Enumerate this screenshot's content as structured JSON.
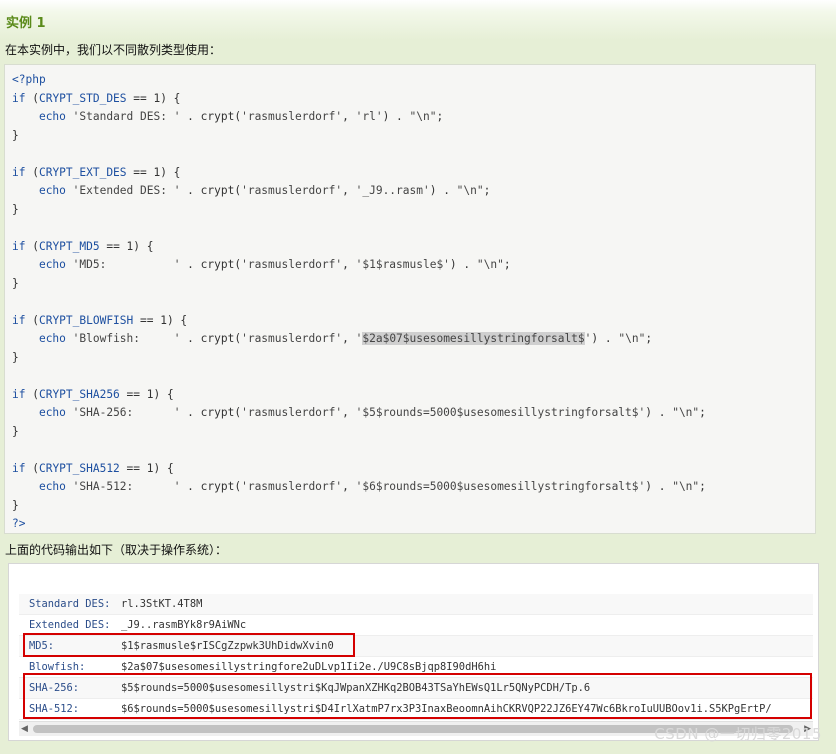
{
  "heading": "实例 1",
  "intro_text": "在本实例中，我们以不同散列类型使用：",
  "code": {
    "open_tag": "<?php",
    "close_tag": "?>",
    "blocks": [
      {
        "const": "CRYPT_STD_DES",
        "label": "'Standard DES: '",
        "salt": "'rl'"
      },
      {
        "const": "CRYPT_EXT_DES",
        "label": "'Extended DES: '",
        "salt": "'_J9..rasm'"
      },
      {
        "const": "CRYPT_MD5",
        "label": "'MD5:          '",
        "salt": "'$1$rasmusle$'"
      },
      {
        "const": "CRYPT_BLOWFISH",
        "label": "'Blowfish:     '",
        "salt_prefix": "'",
        "salt_hl": "$2a$07$usesomesillystringforsalt$",
        "salt_suffix": "'"
      },
      {
        "const": "CRYPT_SHA256",
        "label": "'SHA-256:      '",
        "salt": "'$5$rounds=5000$usesomesillystringforsalt$'"
      },
      {
        "const": "CRYPT_SHA512",
        "label": "'SHA-512:      '",
        "salt": "'$6$rounds=5000$usesomesillystringforsalt$'"
      }
    ],
    "kw_if": "if",
    "kw_echo": "echo",
    "func": "crypt",
    "password": "'rasmuslerdorf'",
    "newline": "\"\\n\""
  },
  "output_label": "上面的代码输出如下（取决于操作系统）：",
  "output": [
    {
      "key": "Standard DES:",
      "value": "rl.3StKT.4T8M"
    },
    {
      "key": "Extended DES:",
      "value": "_J9..rasmBYk8r9AiWNc"
    },
    {
      "key": "MD5:",
      "value": "$1$rasmusle$rISCgZzpwk3UhDidwXvin0"
    },
    {
      "key": "Blowfish:",
      "value": "$2a$07$usesomesillystringfore2uDLvp1Ii2e./U9C8sBjqp8I90dH6hi"
    },
    {
      "key": "SHA-256:",
      "value": "$5$rounds=5000$usesomesillystri$KqJWpanXZHKq2BOB43TSaYhEWsQ1Lr5QNyPCDH/Tp.6"
    },
    {
      "key": "SHA-512:",
      "value": "$6$rounds=5000$usesomesillystri$D4IrlXatmP7rx3P3InaxBeoomnAihCKRVQP22JZ6EY47Wc6BkroIuUUBOov1i.S5KPgErtP/"
    }
  ],
  "watermark": "CSDN @一切归零2015",
  "colors": {
    "accent": "#5a8a1a",
    "keyword": "#1d4fa0",
    "highlight_box": "#d40000"
  }
}
